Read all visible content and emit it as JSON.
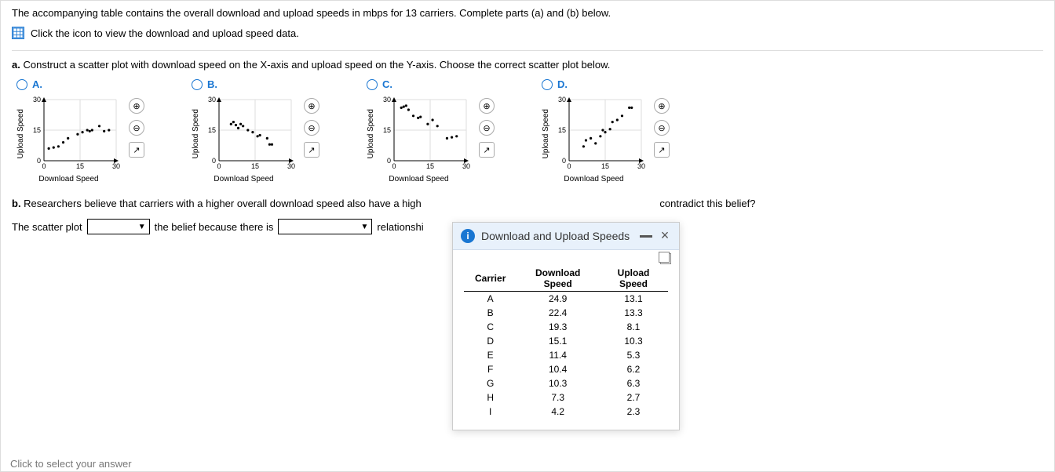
{
  "intro": "The accompanying table contains the overall download and upload speeds in mbps for 13 carriers. Complete parts (a) and (b) below.",
  "icon_hint": "Click the icon to view the download and upload speed data.",
  "part_a": {
    "prefix": "a. ",
    "text": "Construct a scatter plot with download speed on the X-axis and upload speed on the Y-axis. Choose the correct scatter plot below."
  },
  "part_b": {
    "prefix": "b. ",
    "text_before": "Researchers believe that carriers with a higher overall download speed also have a high",
    "text_after": "contradict this belief?",
    "sentence_prefix": "The scatter plot",
    "sentence_mid": "the belief because there is",
    "sentence_suffix": "relationshi"
  },
  "chart_common": {
    "xlabel": "Download Speed",
    "ylabel": "Upload Speed",
    "xlim": [
      0,
      30
    ],
    "ylim": [
      0,
      30
    ],
    "xticks": [
      0,
      15,
      30
    ],
    "yticks": [
      0,
      15,
      30
    ]
  },
  "chart_data": [
    {
      "type": "scatter",
      "option": "A.",
      "x": [
        2,
        4,
        6,
        8,
        10,
        14,
        16,
        18,
        19,
        20,
        23,
        25,
        27
      ],
      "y": [
        6,
        6.5,
        7,
        9,
        11,
        13,
        14,
        15,
        14.5,
        15,
        17,
        14.5,
        15
      ]
    },
    {
      "type": "scatter",
      "option": "B.",
      "x": [
        5,
        6,
        7,
        8,
        9,
        10,
        12,
        14,
        16,
        17,
        20,
        21,
        22
      ],
      "y": [
        18,
        19,
        17.5,
        16,
        18,
        17,
        15,
        14,
        12,
        12.5,
        11,
        8,
        8
      ]
    },
    {
      "type": "scatter",
      "option": "C.",
      "x": [
        3,
        4,
        5,
        6,
        8,
        10,
        11,
        14,
        16,
        18,
        22,
        24,
        26
      ],
      "y": [
        26,
        26.5,
        27,
        25,
        22,
        21,
        21.5,
        18,
        20,
        17,
        11,
        11.5,
        12
      ]
    },
    {
      "type": "scatter",
      "option": "D.",
      "x": [
        6,
        7,
        9,
        11,
        13,
        14,
        15,
        17,
        18,
        20,
        22,
        25,
        26
      ],
      "y": [
        7,
        10,
        11,
        8.5,
        12,
        15,
        14,
        15.5,
        19,
        20,
        22,
        26,
        26
      ]
    }
  ],
  "controls": {
    "zoom_in": "⊕",
    "zoom_out": "⊖",
    "open": "↗"
  },
  "dialog": {
    "title": "Download and Upload Speeds",
    "headers": [
      "Carrier",
      "Download Speed",
      "Upload Speed"
    ],
    "rows": [
      {
        "c": "A",
        "d": "24.9",
        "u": "13.1"
      },
      {
        "c": "B",
        "d": "22.4",
        "u": "13.3"
      },
      {
        "c": "C",
        "d": "19.3",
        "u": "8.1"
      },
      {
        "c": "D",
        "d": "15.1",
        "u": "10.3"
      },
      {
        "c": "E",
        "d": "11.4",
        "u": "5.3"
      },
      {
        "c": "F",
        "d": "10.4",
        "u": "6.2"
      },
      {
        "c": "G",
        "d": "10.3",
        "u": "6.3"
      },
      {
        "c": "H",
        "d": "7.3",
        "u": "2.7"
      },
      {
        "c": "I",
        "d": "4.2",
        "u": "2.3"
      }
    ]
  },
  "footer": "Click to select your answer"
}
